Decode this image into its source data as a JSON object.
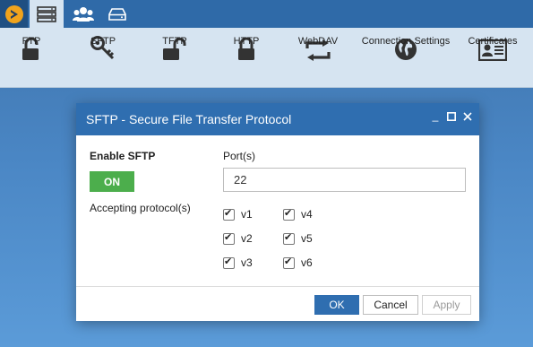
{
  "toolbar_tabs": [
    {
      "icon": "server-icon",
      "active": true
    },
    {
      "icon": "users-icon",
      "active": false
    },
    {
      "icon": "drive-icon",
      "active": false
    }
  ],
  "ribbon": {
    "items": [
      {
        "label": "FTP",
        "icon": "lock-open-icon"
      },
      {
        "label": "SFTP",
        "icon": "key-icon"
      },
      {
        "label": "TFTP",
        "icon": "lock-open-icon"
      },
      {
        "label": "HTTP",
        "icon": "lock-icon"
      },
      {
        "label": "WebDAV",
        "icon": "sync-arrows-icon"
      },
      {
        "label": "Connection Settings",
        "icon": "globe-icon"
      },
      {
        "label": "Certificates",
        "icon": "id-card-icon"
      }
    ]
  },
  "dialog": {
    "title": "SFTP - Secure File Transfer Protocol",
    "enable_label": "Enable SFTP",
    "toggle_label": "ON",
    "port_label": "Port(s)",
    "port_value": "22",
    "accepting_label": "Accepting protocol(s)",
    "protocols": [
      {
        "label": "v1",
        "checked": true
      },
      {
        "label": "v2",
        "checked": true
      },
      {
        "label": "v3",
        "checked": true
      },
      {
        "label": "v4",
        "checked": true
      },
      {
        "label": "v5",
        "checked": true
      },
      {
        "label": "v6",
        "checked": true
      }
    ],
    "buttons": {
      "ok": "OK",
      "cancel": "Cancel",
      "apply": "Apply"
    },
    "window_controls": {
      "minimize": "_",
      "maximize": "□",
      "close": "✕"
    }
  },
  "colors": {
    "accent": "#2f6eb0",
    "toggle_on": "#4cae4c",
    "logo": "#f0a31c"
  }
}
